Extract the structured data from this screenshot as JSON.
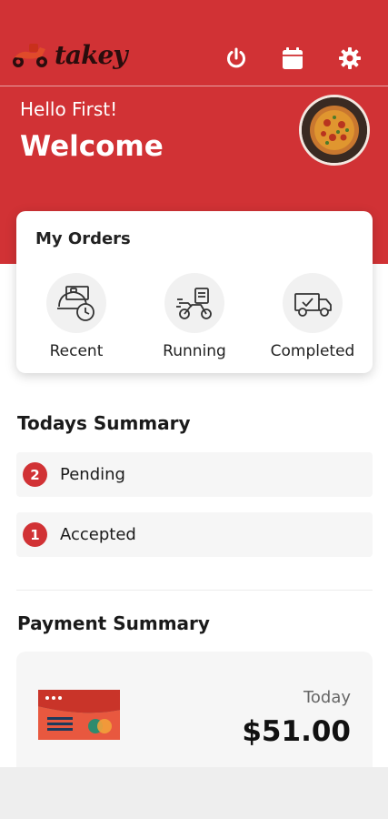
{
  "brand": {
    "name": "takey"
  },
  "top_actions": [
    {
      "icon": "power-icon"
    },
    {
      "icon": "calendar-icon"
    },
    {
      "icon": "gear-icon"
    }
  ],
  "greeting": "Hello First!",
  "welcome": "Welcome",
  "orders": {
    "title": "My Orders",
    "items": [
      {
        "label": "Recent",
        "icon": "recent-orders-icon"
      },
      {
        "label": "Running",
        "icon": "delivery-scooter-icon"
      },
      {
        "label": "Completed",
        "icon": "delivery-truck-icon"
      }
    ]
  },
  "todays_summary": {
    "title": "Todays Summary",
    "rows": [
      {
        "count": "2",
        "label": "Pending"
      },
      {
        "count": "1",
        "label": "Accepted"
      }
    ]
  },
  "payment_summary": {
    "title": "Payment Summary",
    "period": "Today",
    "amount": "$51.00",
    "icon": "credit-card-icon"
  },
  "colors": {
    "accent": "#d13235",
    "card_bg": "#f6f6f6"
  }
}
